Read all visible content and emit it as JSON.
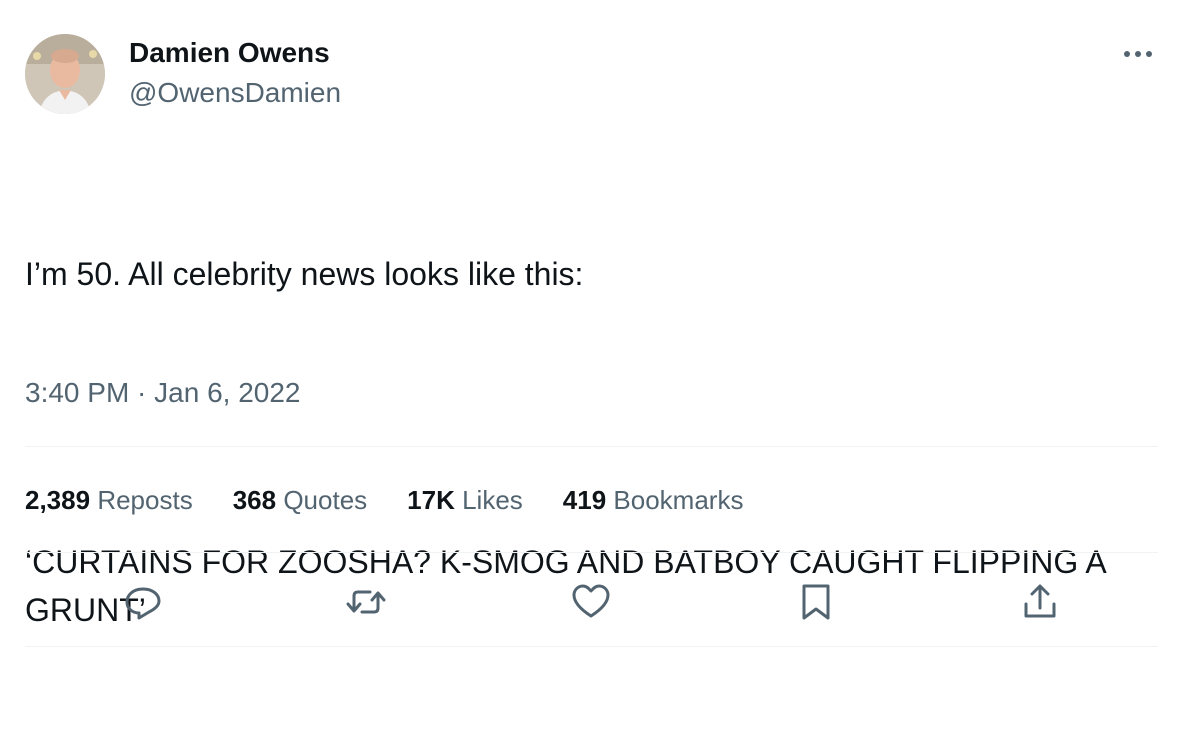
{
  "author": {
    "name": "Damien Owens",
    "handle": "@OwensDamien"
  },
  "tweet": {
    "line1": "I’m 50. All celebrity news looks like this:",
    "line2": "‘CURTAINS FOR ZOOSHA? K-SMOG AND BATBOY CAUGHT FLIPPING A GRUNT’",
    "timestamp": "3:40 PM · Jan 6, 2022"
  },
  "stats": {
    "reposts_count": "2,389",
    "reposts_label": "Reposts",
    "quotes_count": "368",
    "quotes_label": "Quotes",
    "likes_count": "17K",
    "likes_label": "Likes",
    "bookmarks_count": "419",
    "bookmarks_label": "Bookmarks"
  },
  "icons": {
    "more": "more-horizontal-icon",
    "reply": "reply-icon",
    "repost": "repost-icon",
    "like": "heart-icon",
    "bookmark": "bookmark-icon",
    "share": "share-icon"
  },
  "colors": {
    "text": "#0f1419",
    "secondary": "#536471",
    "divider": "#eff3f4"
  }
}
